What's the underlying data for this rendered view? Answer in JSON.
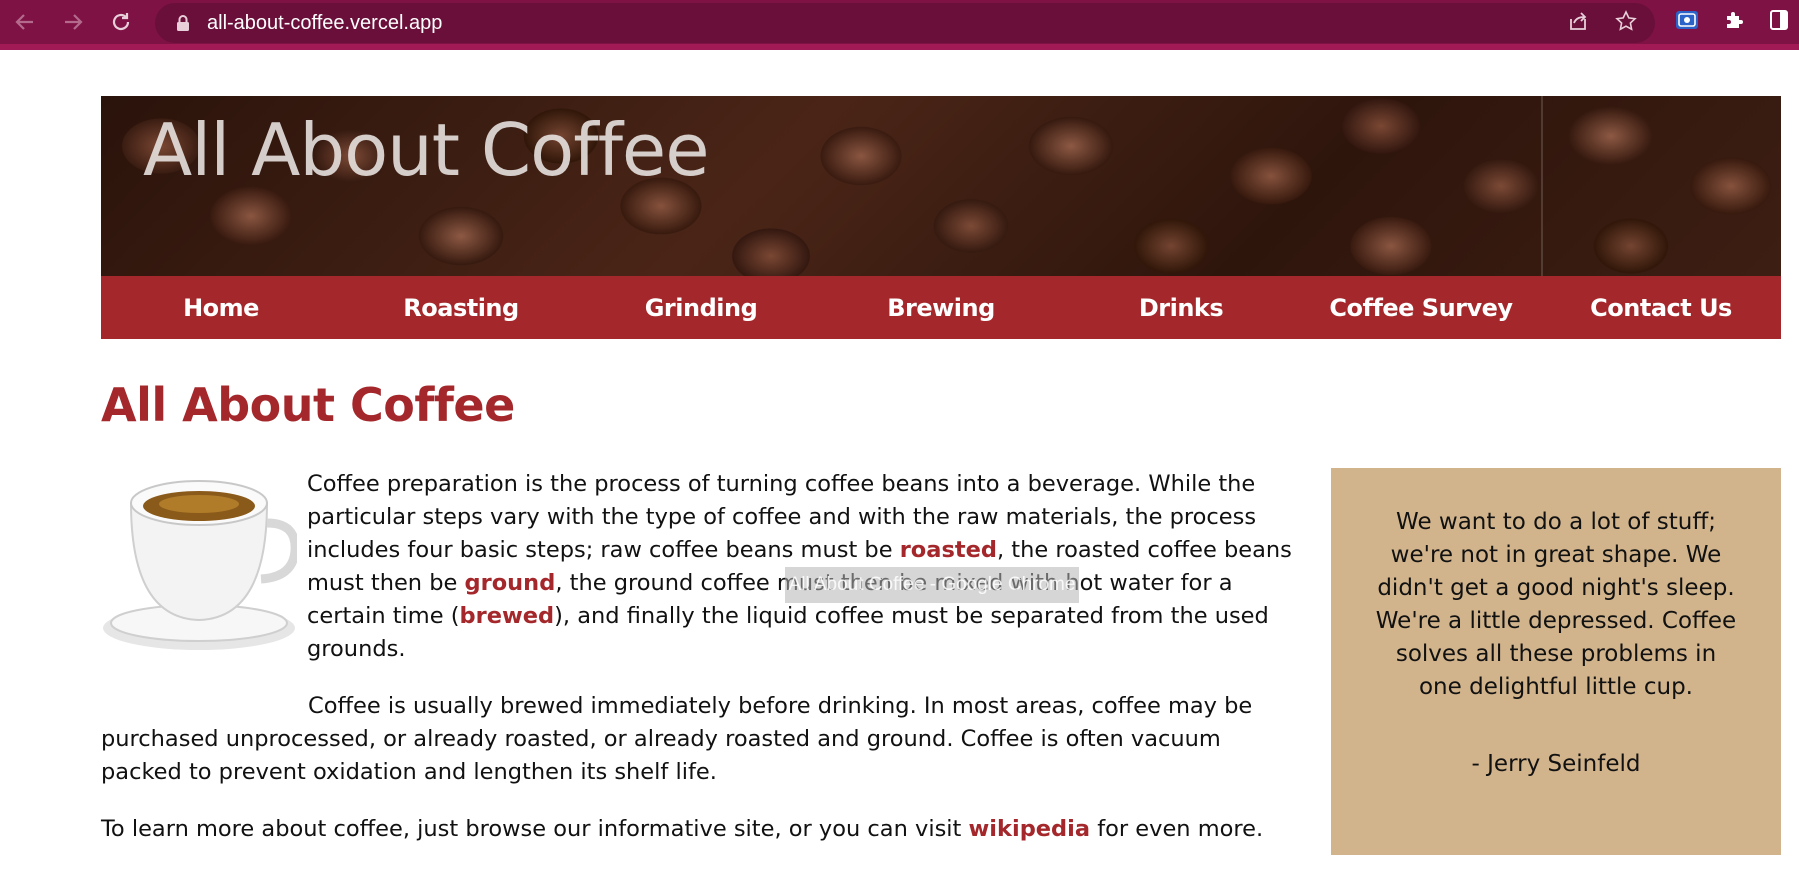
{
  "browser": {
    "url": "all-about-coffee.vercel.app"
  },
  "banner": {
    "title": "All About Coffee"
  },
  "nav": {
    "items": [
      {
        "label": "Home"
      },
      {
        "label": "Roasting"
      },
      {
        "label": "Grinding"
      },
      {
        "label": "Brewing"
      },
      {
        "label": "Drinks"
      },
      {
        "label": "Coffee Survey"
      },
      {
        "label": "Contact Us"
      }
    ]
  },
  "main": {
    "title": "All About Coffee",
    "p1": {
      "t1": "Coffee preparation is the process of turning coffee beans into a beverage. While the particular steps vary with the type of coffee and with the raw materials, the process includes four basic steps; raw coffee beans must be ",
      "link1": "roasted",
      "t2": ", the roasted coffee beans must then be ",
      "link2": "ground",
      "t3": ", the ground coffee must then be mixed with hot water for a certain time (",
      "link3": "brewed",
      "t4": "), and finally the liquid coffee must be separated from the used grounds."
    },
    "p2": "Coffee is usually brewed immediately before drinking. In most areas, coffee may be purchased unprocessed, or already roasted, or already roasted and ground. Coffee is often vacuum packed to prevent oxidation and lengthen its shelf life.",
    "p3": {
      "t1": "To learn more about coffee, just browse our informative site, or you can visit ",
      "link": "wikipedia",
      "t2": " for even more."
    },
    "tooltip": "All About Coffee - Google Chrome"
  },
  "quote": {
    "text": "We want to do a lot of stuff; we're not in great shape. We didn't get a good night's sleep. We're a little depressed. Coffee solves all these problems in one delightful little cup.",
    "author": "- Jerry Seinfeld"
  },
  "colors": {
    "chrome": "#7e1245",
    "accent": "#a4282b",
    "quote_bg": "#d2b48c"
  }
}
